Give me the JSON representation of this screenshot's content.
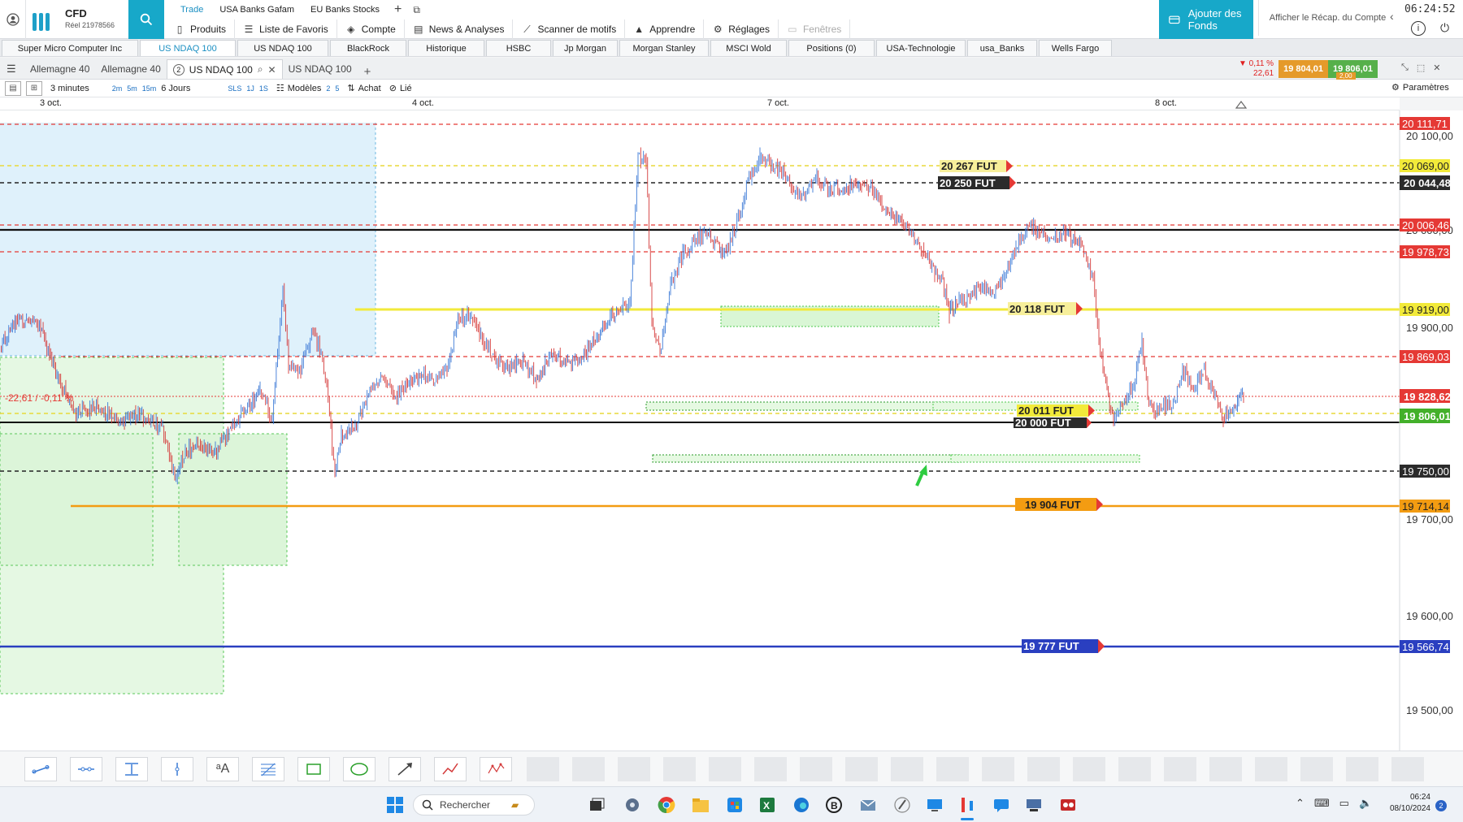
{
  "header": {
    "brand_name": "CFD",
    "account_label": "Réel 21978566",
    "top_tabs": [
      {
        "label": "Trade",
        "active": true
      },
      {
        "label": "USA Banks Gafam",
        "active": false
      },
      {
        "label": "EU Banks Stocks",
        "active": false
      }
    ],
    "menu": [
      {
        "label": "Produits",
        "icon": "phone-icon",
        "disabled": false
      },
      {
        "label": "Liste de Favoris",
        "icon": "list-icon",
        "disabled": false
      },
      {
        "label": "Compte",
        "icon": "tag-icon",
        "disabled": false
      },
      {
        "label": "News & Analyses",
        "icon": "news-icon",
        "disabled": false
      },
      {
        "label": "Scanner de motifs",
        "icon": "pattern-icon",
        "disabled": false
      },
      {
        "label": "Apprendre",
        "icon": "graduation-icon",
        "disabled": false
      },
      {
        "label": "Réglages",
        "icon": "gear-icon",
        "disabled": false
      },
      {
        "label": "Fenêtres",
        "icon": "window-icon",
        "disabled": true
      }
    ],
    "add_funds": "Ajouter des Fonds",
    "recap_link": "Afficher le Récap. du Compte",
    "clock": "06:24:52"
  },
  "watchlist_tabs": [
    {
      "label": "Super Micro Computer Inc",
      "active": false
    },
    {
      "label": "US NDAQ 100",
      "active": true
    },
    {
      "label": "US NDAQ 100",
      "active": false
    },
    {
      "label": "BlackRock",
      "active": false
    },
    {
      "label": "Historique",
      "active": false
    },
    {
      "label": "HSBC",
      "active": false
    },
    {
      "label": "Jp Morgan",
      "active": false
    },
    {
      "label": "Morgan Stanley",
      "active": false
    },
    {
      "label": "MSCI Wold",
      "active": false
    },
    {
      "label": "Positions (0)",
      "active": false
    },
    {
      "label": "USA-Technologie",
      "active": false
    },
    {
      "label": "usa_Banks",
      "active": false
    },
    {
      "label": "Wells Fargo",
      "active": false
    }
  ],
  "chart_tabs": [
    {
      "label": "Allemagne 40",
      "active": false
    },
    {
      "label": "Allemagne 40",
      "active": false
    },
    {
      "label": "US NDAQ 100",
      "active": true,
      "badge": "2"
    },
    {
      "label": "US NDAQ 100",
      "active": false
    }
  ],
  "quote": {
    "change_pct": "▼ 0,11 %",
    "change_pts": "22,61",
    "bid": "19 804,01",
    "ask": "19 806,01",
    "spread": "2,00"
  },
  "toolbar": {
    "interval": "3 minutes",
    "interval_shortcuts": [
      "2m",
      "5m",
      "15m"
    ],
    "range": "6 Jours",
    "sls": "SLS",
    "one_j": "1J",
    "one_s": "1S",
    "models": "Modèles",
    "model_counts": [
      "2",
      "5"
    ],
    "buy": "Achat",
    "linked": "Lié",
    "params": "Paramètres"
  },
  "date_axis": [
    "3 oct.",
    "4 oct.",
    "7 oct.",
    "8 oct."
  ],
  "chart": {
    "price_ticks": [
      "20 100,00",
      "20 000,00",
      "19 900,00",
      "19 700,00",
      "19 600,00",
      "19 500,00"
    ],
    "level_labels": [
      {
        "price": 20111.71,
        "text": "20 111,71",
        "bg": "#e53935",
        "fg": "#ffffff"
      },
      {
        "price": 20069.0,
        "text": "20 069,00",
        "bg": "#f2ea3a",
        "fg": "#222222"
      },
      {
        "price": 20044.48,
        "text": "20 044,48",
        "bg": "#2b2b2b",
        "fg": "#ffffff"
      },
      {
        "price": 20006.46,
        "text": "20 006,46",
        "bg": "#e53935",
        "fg": "#ffffff"
      },
      {
        "price": 19978.73,
        "text": "19 978,73",
        "bg": "#e53935",
        "fg": "#ffffff"
      },
      {
        "price": 19919.0,
        "text": "19 919,00",
        "bg": "#f2ea3a",
        "fg": "#222222"
      },
      {
        "price": 19869.03,
        "text": "19 869,03",
        "bg": "#e53935",
        "fg": "#ffffff"
      },
      {
        "price": 19828.62,
        "text": "19 828,62",
        "bg": "#e53935",
        "fg": "#ffffff"
      },
      {
        "price": 19806.01,
        "text": "19 806,01",
        "bg": "#43b02a",
        "fg": "#ffffff"
      },
      {
        "price": 19750.0,
        "text": "19 750,00",
        "bg": "#2b2b2b",
        "fg": "#ffffff"
      },
      {
        "price": 19714.14,
        "text": "19 714,14",
        "bg": "#f39c12",
        "fg": "#222222"
      },
      {
        "price": 19566.74,
        "text": "19 566,74",
        "bg": "#2a3fc0",
        "fg": "#ffffff"
      }
    ],
    "order_tags": [
      {
        "text": "20 267 FUT",
        "bg": "#f7ef9a",
        "fg": "#222222"
      },
      {
        "text": "20 250 FUT",
        "bg": "#2b2b2b",
        "fg": "#ffffff"
      },
      {
        "text": "20 118 FUT",
        "bg": "#f7ef9a",
        "fg": "#222222"
      },
      {
        "text": "20 011 FUT",
        "bg": "#f2ea3a",
        "fg": "#222222"
      },
      {
        "text": "20 000 FUT",
        "bg": "#2b2b2b",
        "fg": "#ffffff"
      },
      {
        "text": "19 904 FUT",
        "bg": "#f39c12",
        "fg": "#222222"
      },
      {
        "text": "19 777 FUT",
        "bg": "#2a3fc0",
        "fg": "#ffffff"
      }
    ],
    "change_text": "-22,61 / -0,11 %",
    "colors": {
      "up": "#3a78d6",
      "down": "#d43a3a"
    }
  },
  "taskbar": {
    "search_placeholder": "Rechercher",
    "time": "06:24",
    "date": "08/10/2024",
    "notifications": "2"
  }
}
